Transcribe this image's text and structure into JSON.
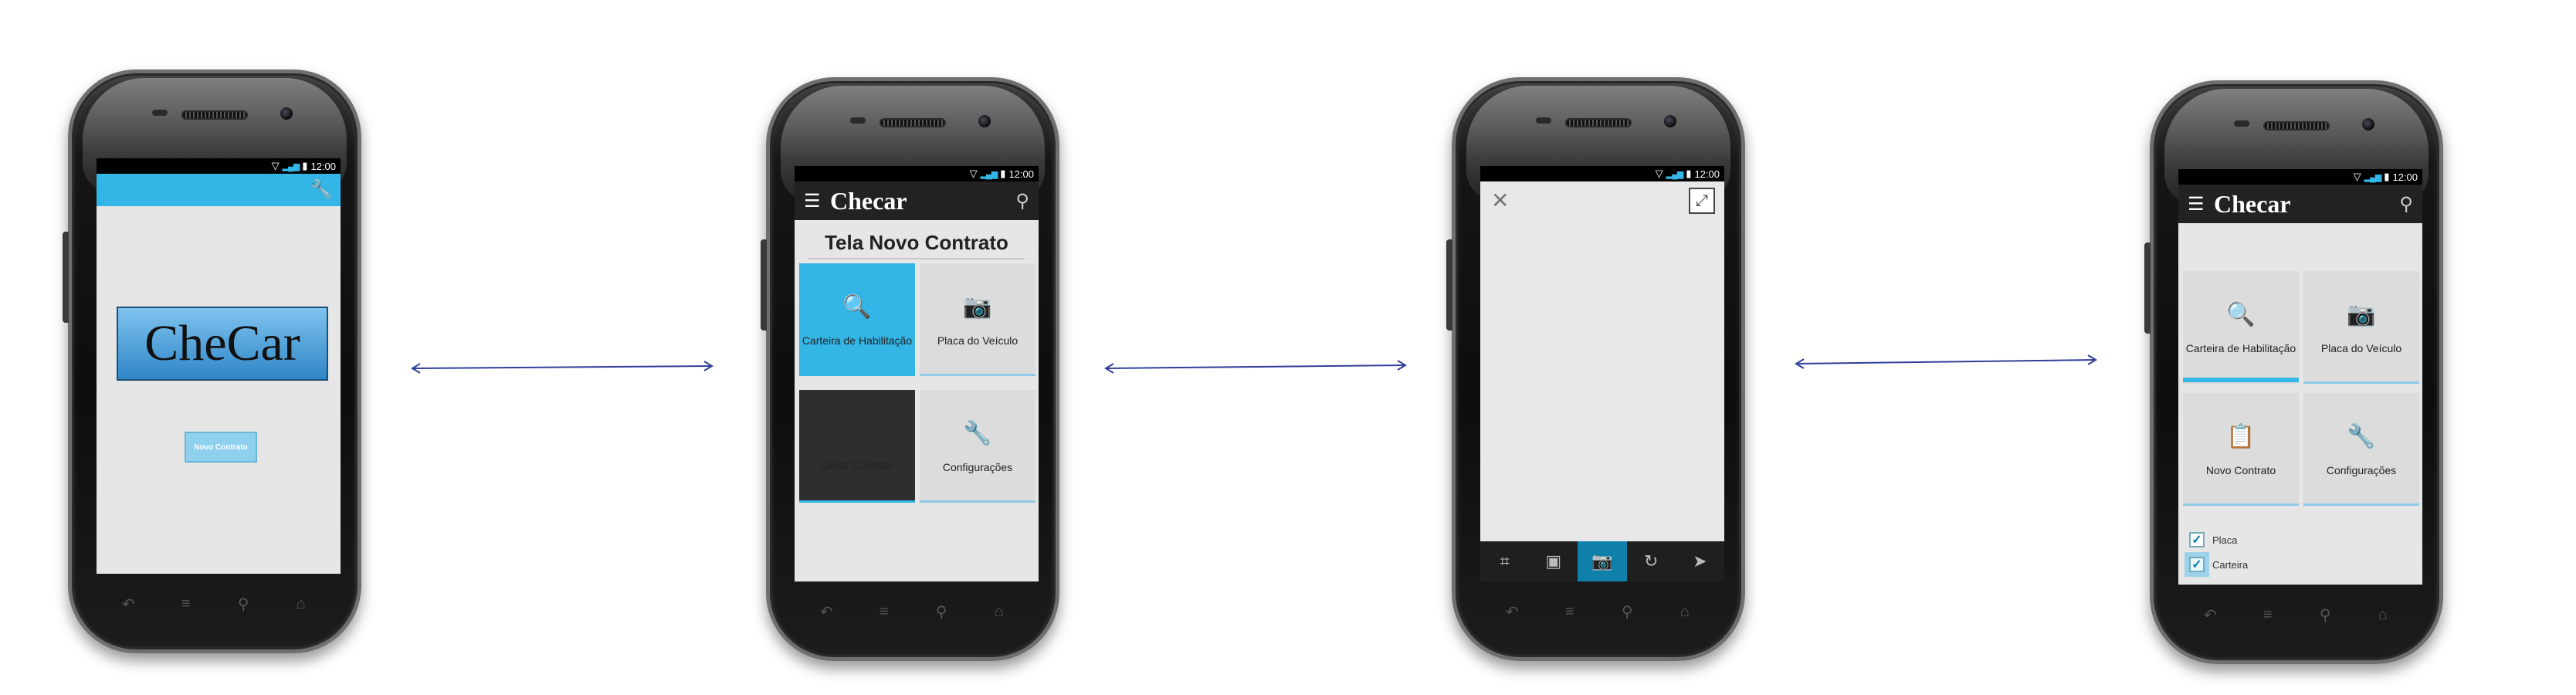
{
  "colors": {
    "accent": "#33b5e5",
    "arrow": "#2f3f9a",
    "actionbar": "#222222"
  },
  "status_time": "12:00",
  "screen1": {
    "logo": "CheCar",
    "button_label": "Novo Contrato",
    "toolbar_icon": "wrench-menu-icon"
  },
  "screen2": {
    "app_title": "Checar",
    "form_title": "Tela Novo Contrato",
    "tiles": [
      {
        "label": "Carteira de Habilitação",
        "icon": "documents-search-icon",
        "state": "selected"
      },
      {
        "label": "Placa do Veículo",
        "icon": "camera-icon",
        "state": "normal"
      },
      {
        "label": "Gerar Contrato",
        "icon": "none",
        "state": "dark"
      },
      {
        "label": "Configurações",
        "icon": "wrench-icon",
        "state": "normal"
      }
    ]
  },
  "screen3": {
    "toolbar_icons": [
      "crop-icon",
      "gallery-icon",
      "camera-icon",
      "rotate-icon",
      "send-icon"
    ],
    "active_index": 2
  },
  "screen4": {
    "app_title": "Checar",
    "tiles": [
      {
        "label": "Carteira de Habilitação",
        "icon": "documents-search-icon"
      },
      {
        "label": "Placa do Veículo",
        "icon": "camera-icon"
      },
      {
        "label": "Novo Contrato",
        "icon": "clipboard-icon"
      },
      {
        "label": "Configurações",
        "icon": "wrench-icon"
      }
    ],
    "checks": [
      {
        "label": "Placa",
        "checked": true
      },
      {
        "label": "Carteira",
        "checked": true
      }
    ]
  }
}
